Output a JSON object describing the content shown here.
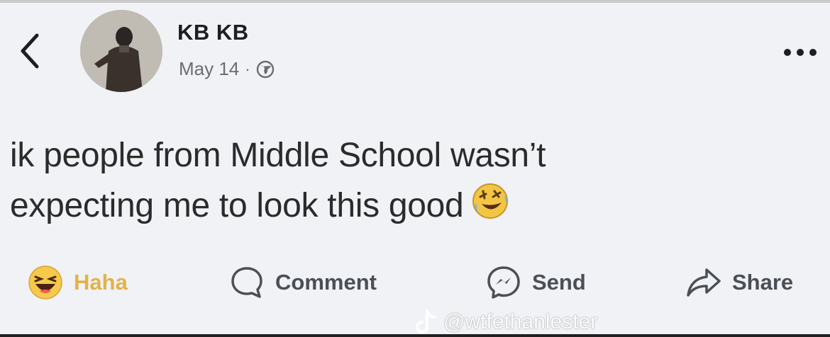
{
  "post": {
    "author": "KB KB",
    "date": "May 14",
    "separator": "·",
    "privacy_icon": "globe-icon",
    "text_line1": "ik people from Middle School wasn’t",
    "text_line2": "expecting me to look this good",
    "emoji": "rolling-on-floor-laughing-emoji"
  },
  "actions": {
    "reaction_label": "Haha",
    "comment_label": "Comment",
    "send_label": "Send",
    "share_label": "Share"
  },
  "watermark": {
    "handle": "@wtfethanlester",
    "icon": "tiktok-icon"
  },
  "colors": {
    "background": "#f0f2f5",
    "haha_accent": "#e2b24a",
    "muted_text": "#6a6d73"
  }
}
